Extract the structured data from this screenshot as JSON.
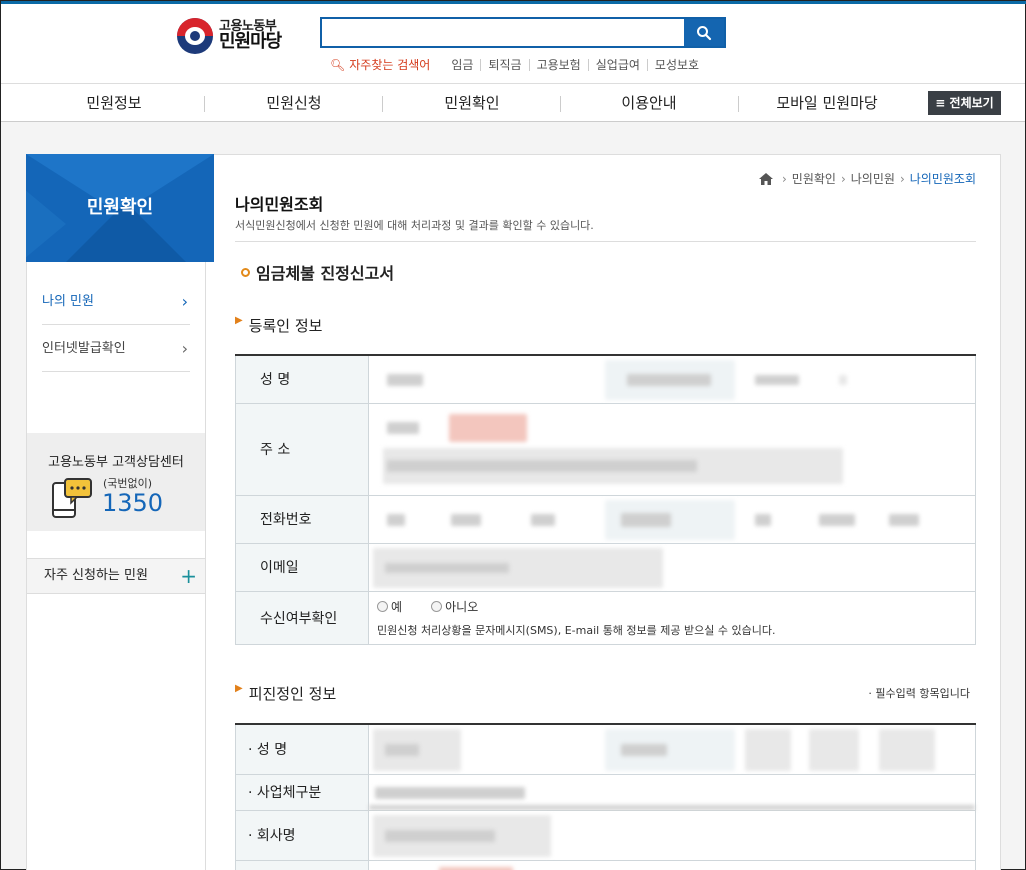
{
  "header": {
    "logo_line1": "고용노동부",
    "logo_line2": "민원마당",
    "search_placeholder": "",
    "popular_label": "자주찾는 검색어",
    "keywords": [
      "임금",
      "퇴직금",
      "고용보험",
      "실업급여",
      "모성보호"
    ]
  },
  "gnb": {
    "items": [
      "민원정보",
      "민원신청",
      "민원확인",
      "이용안내",
      "모바일 민원마당"
    ],
    "all_view": "≡ 전체보기"
  },
  "lnb": {
    "title": "민원확인",
    "items": [
      {
        "label": "나의 민원",
        "active": true
      },
      {
        "label": "인터넷발급확인",
        "active": false
      }
    ],
    "cs_title": "고용노동부 고객상담센터",
    "cs_sub": "(국번없이)",
    "cs_number": "1350",
    "fav_label": "자주 신청하는 민원"
  },
  "breadcrumb": [
    "민원확인",
    "나의민원",
    "나의민원조회"
  ],
  "page": {
    "title": "나의민원조회",
    "desc": "서식민원신청에서 신청한 민원에 대해 처리과정 및 결과를 확인할 수 있습니다.",
    "form_title": "임금체불 진정신고서"
  },
  "section1": {
    "title": "등록인 정보",
    "rows": {
      "name": "성 명",
      "address": "주 소",
      "phone": "전화번호",
      "email": "이메일",
      "consent": "수신여부확인"
    },
    "radio_yes": "예",
    "radio_no": "아니오",
    "consent_note": "민원신청 처리상황을 문자메시지(SMS), E-mail 통해 정보를 제공 받으실 수 있습니다."
  },
  "section2": {
    "title": "피진정인 정보",
    "required_note": "· 필수입력 항목입니다",
    "rows": {
      "name": "· 성 명",
      "biz_type": "· 사업체구분",
      "company": "· 회사명"
    }
  },
  "colors": {
    "brand_blue": "#1466b8",
    "accent_orange": "#e2801a",
    "search_border": "#1060a8"
  }
}
